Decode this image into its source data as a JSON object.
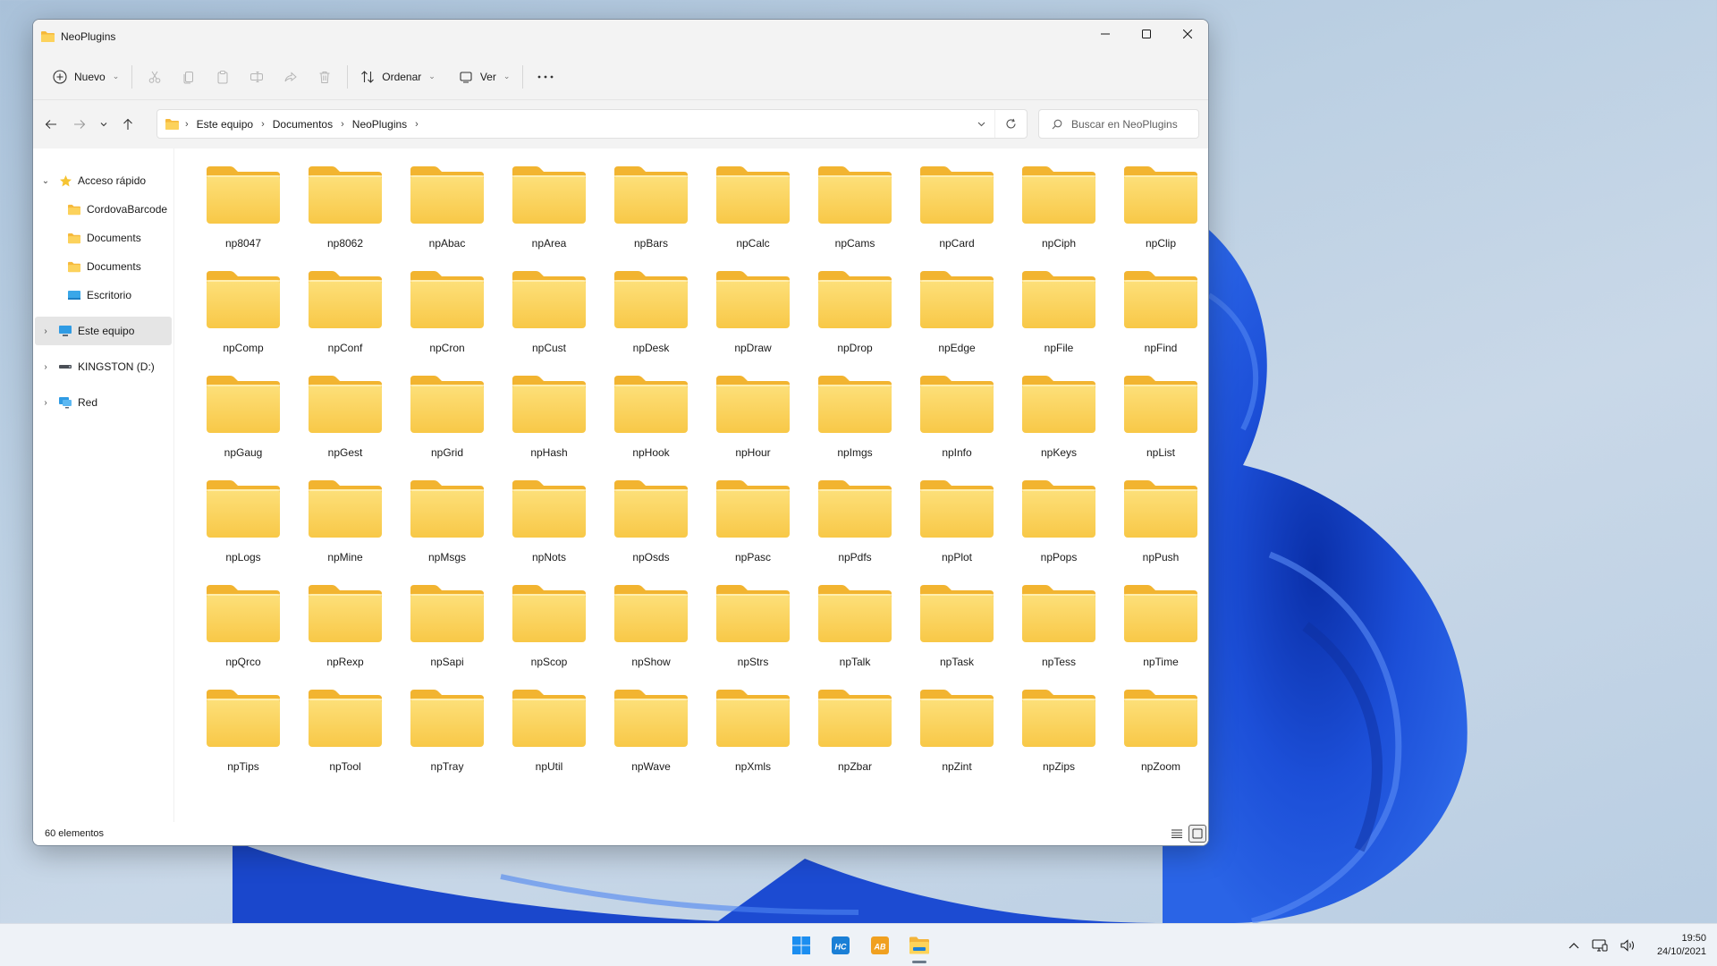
{
  "window": {
    "title": "NeoPlugins",
    "controls": {
      "minimize": "minimize-icon",
      "maximize": "maximize-icon",
      "close": "close-icon"
    }
  },
  "commandbar": {
    "new_label": "Nuevo",
    "sort_label": "Ordenar",
    "view_label": "Ver",
    "icons": [
      "cut-icon",
      "copy-icon",
      "paste-icon",
      "rename-icon",
      "share-icon",
      "delete-icon"
    ]
  },
  "address": {
    "breadcrumbs": [
      "Este equipo",
      "Documentos",
      "NeoPlugins"
    ],
    "search_placeholder": "Buscar en NeoPlugins"
  },
  "sidebar": {
    "quick_access": "Acceso rápido",
    "pinned": [
      "CordovaBarcode",
      "Documents",
      "Documents",
      "Escritorio"
    ],
    "this_pc": "Este equipo",
    "drive": "KINGSTON (D:)",
    "network": "Red"
  },
  "folders": [
    "np8047",
    "np8062",
    "npAbac",
    "npArea",
    "npBars",
    "npCalc",
    "npCams",
    "npCard",
    "npCiph",
    "npClip",
    "npComp",
    "npConf",
    "npCron",
    "npCust",
    "npDesk",
    "npDraw",
    "npDrop",
    "npEdge",
    "npFile",
    "npFind",
    "npGaug",
    "npGest",
    "npGrid",
    "npHash",
    "npHook",
    "npHour",
    "npImgs",
    "npInfo",
    "npKeys",
    "npList",
    "npLogs",
    "npMine",
    "npMsgs",
    "npNots",
    "npOsds",
    "npPasc",
    "npPdfs",
    "npPlot",
    "npPops",
    "npPush",
    "npQrco",
    "npRexp",
    "npSapi",
    "npScop",
    "npShow",
    "npStrs",
    "npTalk",
    "npTask",
    "npTess",
    "npTime",
    "npTips",
    "npTool",
    "npTray",
    "npUtil",
    "npWave",
    "npXmls",
    "npZbar",
    "npZint",
    "npZips",
    "npZoom"
  ],
  "status": {
    "item_count": "60 elementos"
  },
  "taskbar": {
    "apps": [
      "windows-start",
      "hc-app",
      "ab-app",
      "file-explorer"
    ],
    "time": "19:50",
    "date": "24/10/2021"
  },
  "colors": {
    "accent": "#0067c0",
    "folder": "#fcc94d",
    "wallpaper_bloom": "#1846c9"
  }
}
